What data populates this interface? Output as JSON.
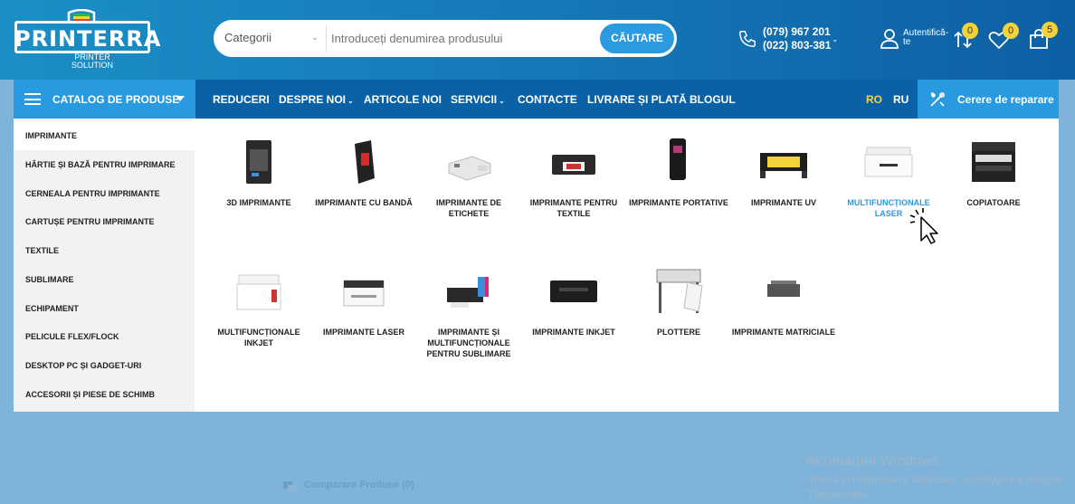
{
  "brand": {
    "name": "PRINTERRA",
    "tagline_1": "PRINTER",
    "tagline_2": "SOLUTION"
  },
  "search": {
    "category": "Categorii",
    "placeholder": "Introduceți denumirea produsului",
    "button": "CĂUTARE"
  },
  "contact": {
    "phone_1": "(079) 967 201",
    "phone_2": "(022) 803-381"
  },
  "account": {
    "label": "Autentifică-te"
  },
  "badges": {
    "compare": "0",
    "wishlist": "0",
    "cart": "5"
  },
  "nav": {
    "catalog": "CATALOG DE PRODUSE",
    "items": [
      "REDUCERI",
      "DESPRE NOI",
      "ARTICOLE NOI",
      "SERVICII",
      "CONTACTE",
      "LIVRARE ȘI PLATĂ",
      "BLOGUL"
    ],
    "lang_ro": "RO",
    "lang_ru": "RU",
    "repair": "Cerere de reparare"
  },
  "sidebar": [
    "IMPRIMANTE",
    "HÂRTIE ȘI BAZĂ PENTRU IMPRIMARE",
    "CERNEALA PENTRU IMPRIMANTE",
    "CARTUȘE PENTRU IMPRIMANTE",
    "TEXTILE",
    "SUBLIMARE",
    "ECHIPAMENT",
    "PELICULE FLEX/FLOCK",
    "DESKTOP PC ȘI GADGET-URI",
    "ACCESORII ȘI PIESE DE SCHIMB"
  ],
  "products": [
    "3D IMPRIMANTE",
    "IMPRIMANTE CU BANDĂ",
    "IMPRIMANTE DE ETICHETE",
    "IMPRIMANTE PENTRU TEXTILE",
    "IMPRIMANTE PORTATIVE",
    "IMPRIMANTE UV",
    "MULTIFUNCȚIONALE LASER",
    "COPIATOARE",
    "MULTIFUNCȚIONALE INKJET",
    "IMPRIMANTE LASER",
    "IMPRIMANTE ȘI MULTIFUNCȚIONALE PENTRU SUBLIMARE",
    "IMPRIMANTE INKJET",
    "PLOTTERE",
    "IMPRIMANTE MATRICIALE"
  ],
  "overlay": {
    "win_title": "Активация Windows",
    "win_sub": "Чтобы активировать Windows, перейдите в раздел \"Параметры\".",
    "compare": "Comparare Produse (0)"
  },
  "colors": {
    "header": "#1579b8",
    "nav": "#0b61a5",
    "accent": "#2a9ae0",
    "badge": "#f2d33a"
  }
}
